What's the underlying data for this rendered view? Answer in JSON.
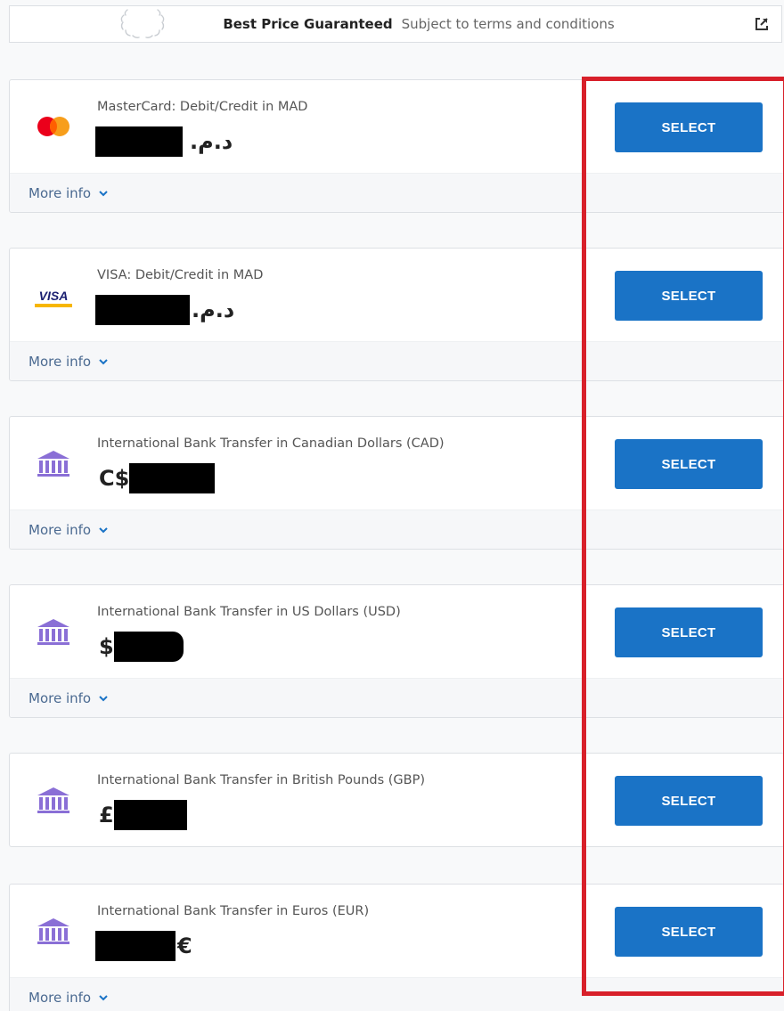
{
  "banner": {
    "title": "Best Price Guaranteed",
    "subtitle": "Subject to terms and conditions",
    "icons": [
      "laurel-wreath-icon",
      "external-link-icon"
    ]
  },
  "more_info_label": "More info",
  "select_label": "SELECT",
  "colors": {
    "button": "#1a73c6",
    "bank_icon": "#8a6fd6",
    "more_info": "#4b6a91",
    "highlight": "#d8202a"
  },
  "methods": [
    {
      "label": "MasterCard: Debit/Credit in MAD",
      "currency_symbol": "د.م.",
      "icon": "mastercard-icon",
      "has_more_info": true
    },
    {
      "label": "VISA: Debit/Credit in MAD",
      "currency_symbol": "د.م.",
      "icon": "visa-icon",
      "has_more_info": true
    },
    {
      "label": "International Bank Transfer in Canadian Dollars (CAD)",
      "currency_symbol": "C$",
      "icon": "bank-icon",
      "has_more_info": true
    },
    {
      "label": "International Bank Transfer in US Dollars (USD)",
      "currency_symbol": "$",
      "icon": "bank-icon",
      "has_more_info": true
    },
    {
      "label": "International Bank Transfer in British Pounds (GBP)",
      "currency_symbol": "£",
      "icon": "bank-icon",
      "has_more_info": false
    },
    {
      "label": "International Bank Transfer in Euros (EUR)",
      "currency_symbol": "€",
      "icon": "bank-icon",
      "has_more_info": true
    }
  ]
}
